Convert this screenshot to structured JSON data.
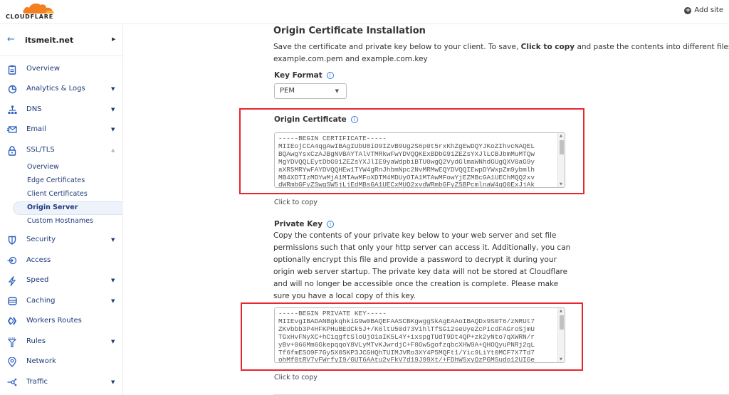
{
  "brand": {
    "name": "CLOUDFLARE",
    "accent": "#f38020"
  },
  "topbar": {
    "add_site_label": "Add site"
  },
  "sidebar": {
    "zone": "itsmeit.net",
    "items": [
      {
        "label": "Overview",
        "icon": "clipboard-icon",
        "expandable": false
      },
      {
        "label": "Analytics & Logs",
        "icon": "pie-chart-icon",
        "expandable": true
      },
      {
        "label": "DNS",
        "icon": "network-tree-icon",
        "expandable": true
      },
      {
        "label": "Email",
        "icon": "email-icon",
        "expandable": true
      },
      {
        "label": "SSL/TLS",
        "icon": "lock-icon",
        "expandable": true,
        "expanded": true
      },
      {
        "label": "Security",
        "icon": "shield-icon",
        "expandable": true
      },
      {
        "label": "Access",
        "icon": "access-icon",
        "expandable": false
      },
      {
        "label": "Speed",
        "icon": "lightning-icon",
        "expandable": true
      },
      {
        "label": "Caching",
        "icon": "server-stack-icon",
        "expandable": true
      },
      {
        "label": "Workers Routes",
        "icon": "workers-icon",
        "expandable": false
      },
      {
        "label": "Rules",
        "icon": "filter-icon",
        "expandable": true
      },
      {
        "label": "Network",
        "icon": "location-pin-icon",
        "expandable": false
      },
      {
        "label": "Traffic",
        "icon": "traffic-icon",
        "expandable": true
      }
    ],
    "ssl_subitems": [
      {
        "label": "Overview",
        "active": false
      },
      {
        "label": "Edge Certificates",
        "active": false
      },
      {
        "label": "Client Certificates",
        "active": false
      },
      {
        "label": "Origin Server",
        "active": true
      },
      {
        "label": "Custom Hostnames",
        "active": false
      }
    ]
  },
  "main": {
    "title": "Origin Certificate Installation",
    "desc_pre": "Save the certificate and private key below to your client. To save, ",
    "desc_bold": "Click to copy",
    "desc_post": " and paste the contents into different files on your c",
    "desc_line2": "example.com.pem and example.com.key",
    "key_format_label": "Key Format",
    "key_format_value": "PEM",
    "origin_cert_label": "Origin Certificate",
    "origin_cert_text": "-----BEGIN CERTIFICATE-----\nMIIEojCCA4qgAwIBAgIUbU8iO9IZvB9Ug2S6p0t5rxKhZgEwDQYJKoZIhvcNAQEL\nBQAwgYsxCzAJBgNVBAYTAlVTMRkwFwYDVQQKExBDbG91ZEZsYXJlLCBJbmMuMTQw\nMgYDVQQLEytDbG91ZEZsYXJlIE9yaWdpbiBTU0wgQ2VydGlmaWNhdGUgQXV0aG9y\naXR5MRYwFAYDVQQHEw1TYW4gRnJhbmNpc2NvMRMwEQYDVQQIEwpDYWxpZm9ybmlh\nMB4XDTIzMDYwMjA1MTAwMFoXDTM4MDUyOTA1MTAwMFowYjEZMBcGA1UEChMQQ2xv\ndWRmbGFyZSwgSW5jLjEdMBsGA1UECxMUQ2xvdWRmbGFyZSBPcmlnaW4gQ0ExJjAk",
    "copy_label": "Click to copy",
    "private_key_label": "Private Key",
    "private_key_desc": "Copy the contents of your private key below to your web server and set file permissions such that only your http server can access it. Additionally, you can optionally encrypt this file and provide a password to decrypt it during your origin web server startup. The private key data will not be stored at Cloudflare and will no longer be accessible once the creation is complete. Please make sure you have a local copy of this key.",
    "private_key_text": "-----BEGIN PRIVATE KEY-----\nMIIEvgIBADANBgkqhkiG9w0BAQEFAASCBKgwggSkAgEAAoIBAQDx9S0T6/zNRUt7\nZKvbbb3P4HFKPHuBEdCk5J+/K6ltU50d73VihlTfSG12seUyeZcPicdFAGroSjmU\nTGxHvFNyXC+hC1qgftSloUjO1aIK5L4Y+ixspgTUdT9Dt4QP+zk2yNto7qXWRN/r\nyBv+066Mm6GkepqqoY8VLyMTvKJwrdjC+F8Gw5gofzqbcXHW9A+QHOQyuPNRj2qL\nTf6fmESO9F7Gy5X0SKP3JCGHQhTUIMJVRo3XY4P5MQFt1/Yic9LiYt0MCF7X7Td7\nohMf0tRV7vFWrfyI9/GUT6AAtu2vFkV7d19J99Xt/+FDhWSxyQzPGMSudo12UIGe",
    "copy_label_2": "Click to copy"
  }
}
